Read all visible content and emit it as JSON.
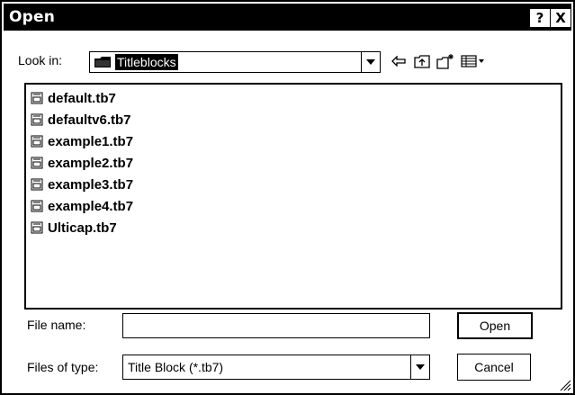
{
  "window": {
    "title": "Open",
    "help_label": "?",
    "close_label": "X"
  },
  "look_in": {
    "label": "Look in:",
    "value": "Titleblocks"
  },
  "toolbar": {
    "icons": [
      "back-arrow-icon",
      "up-folder-icon",
      "new-folder-icon",
      "view-menu-icon"
    ]
  },
  "files": [
    {
      "name": "default.tb7"
    },
    {
      "name": "defaultv6.tb7"
    },
    {
      "name": "example1.tb7"
    },
    {
      "name": "example2.tb7"
    },
    {
      "name": "example3.tb7"
    },
    {
      "name": "example4.tb7"
    },
    {
      "name": "Ulticap.tb7"
    }
  ],
  "file_name": {
    "label": "File name:",
    "value": ""
  },
  "file_type": {
    "label": "Files of type:",
    "value": "Title Block (*.tb7)"
  },
  "buttons": {
    "open": "Open",
    "cancel": "Cancel"
  }
}
